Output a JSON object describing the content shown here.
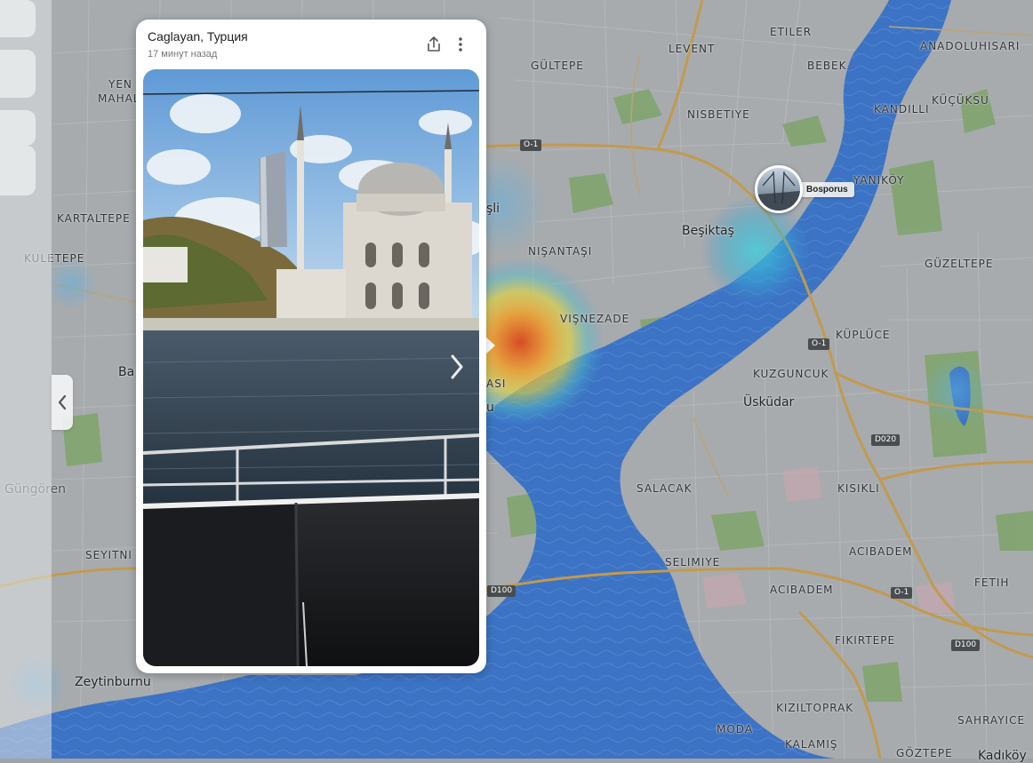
{
  "map": {
    "labels": [
      {
        "id": "levent",
        "text": "LEVENT",
        "kind": "district"
      },
      {
        "id": "etiler",
        "text": "ETILER",
        "kind": "district"
      },
      {
        "id": "anadoluhisari",
        "text": "ANADOLUHISARI",
        "kind": "district"
      },
      {
        "id": "gultepe",
        "text": "GÜLTEPE",
        "kind": "district"
      },
      {
        "id": "bebek",
        "text": "BEBEK",
        "kind": "district"
      },
      {
        "id": "kucuksu",
        "text": "KÜÇÜKSU",
        "kind": "district"
      },
      {
        "id": "kandilli",
        "text": "KANDILLI",
        "kind": "district"
      },
      {
        "id": "nisbetiye",
        "text": "NISBETIYE",
        "kind": "district"
      },
      {
        "id": "yen",
        "text": "YEN",
        "kind": "district"
      },
      {
        "id": "mahal",
        "text": "MAHAL",
        "kind": "district"
      },
      {
        "id": "yanikoy",
        "text": "YANIKÖY",
        "kind": "district"
      },
      {
        "id": "kartaltepe",
        "text": "KARTALTEPE",
        "kind": "district"
      },
      {
        "id": "sisli",
        "text": "şli",
        "kind": "city"
      },
      {
        "id": "besiktas",
        "text": "Beşiktaş",
        "kind": "city"
      },
      {
        "id": "kuletepe",
        "text": "KULETEPE",
        "kind": "district"
      },
      {
        "id": "nisantasi",
        "text": "NIŞANTAŞI",
        "kind": "district"
      },
      {
        "id": "guzeltepe",
        "text": "GÜZELTEPE",
        "kind": "district"
      },
      {
        "id": "visnezade",
        "text": "VIŞNEZADE",
        "kind": "district"
      },
      {
        "id": "kuplice",
        "text": "KÜPLÜCE",
        "kind": "district"
      },
      {
        "id": "ba",
        "text": "Ba",
        "kind": "city"
      },
      {
        "id": "kuzguncuk",
        "text": "KUZGUNCUK",
        "kind": "district"
      },
      {
        "id": "uskudar",
        "text": "Üsküdar",
        "kind": "city"
      },
      {
        "id": "asi",
        "text": "ASI",
        "kind": "district"
      },
      {
        "id": "u",
        "text": "u",
        "kind": "city"
      },
      {
        "id": "gungoren",
        "text": "Güngören",
        "kind": "city"
      },
      {
        "id": "salacak",
        "text": "SALACAK",
        "kind": "district"
      },
      {
        "id": "kisikli",
        "text": "KISIKLI",
        "kind": "district"
      },
      {
        "id": "seyitni",
        "text": "SEYITNI",
        "kind": "district"
      },
      {
        "id": "selimiye",
        "text": "SELIMIYE",
        "kind": "district"
      },
      {
        "id": "acibadem1",
        "text": "ACIBADEM",
        "kind": "district"
      },
      {
        "id": "fetih",
        "text": "FETIH",
        "kind": "district"
      },
      {
        "id": "acibadem2",
        "text": "ACIBADEM",
        "kind": "district"
      },
      {
        "id": "fikirtepe",
        "text": "FIKIRTEPE",
        "kind": "district"
      },
      {
        "id": "zeytinburnu",
        "text": "Zeytinburnu",
        "kind": "city"
      },
      {
        "id": "kiziltoprak",
        "text": "KIZILTOPRAK",
        "kind": "district"
      },
      {
        "id": "sahrayice",
        "text": "SAHRAYICE",
        "kind": "district"
      },
      {
        "id": "moda",
        "text": "MODA",
        "kind": "district"
      },
      {
        "id": "kalamis",
        "text": "KALAMIŞ",
        "kind": "district"
      },
      {
        "id": "goztepe",
        "text": "GÖZTEPE",
        "kind": "district"
      },
      {
        "id": "kadikoy",
        "text": "Kadıköy",
        "kind": "city"
      }
    ],
    "road_shields": [
      {
        "id": "o1a",
        "text": "O-1"
      },
      {
        "id": "o1b",
        "text": "O-1"
      },
      {
        "id": "d020",
        "text": "D020"
      },
      {
        "id": "d100a",
        "text": "D100"
      },
      {
        "id": "o1c",
        "text": "O-1"
      },
      {
        "id": "d100b",
        "text": "D100"
      }
    ],
    "colors": {
      "land": "#a7abae",
      "water": "#3c73c4",
      "park": "#7fa36a",
      "road_major": "#c29a4e",
      "heat_hot": "#e0531e",
      "heat_warm": "#f2c531",
      "heat_cool": "#49c1d6"
    }
  },
  "marker": {
    "label": "Bosporus",
    "icon": "photo-thumbnail"
  },
  "card": {
    "title": "Caglayan, Турция",
    "subtitle": "17 минут назад",
    "share_icon": "share-icon",
    "more_icon": "more-vertical-icon",
    "next_icon": "chevron-right-icon"
  },
  "panel": {
    "collapse_icon": "chevron-left-icon"
  }
}
